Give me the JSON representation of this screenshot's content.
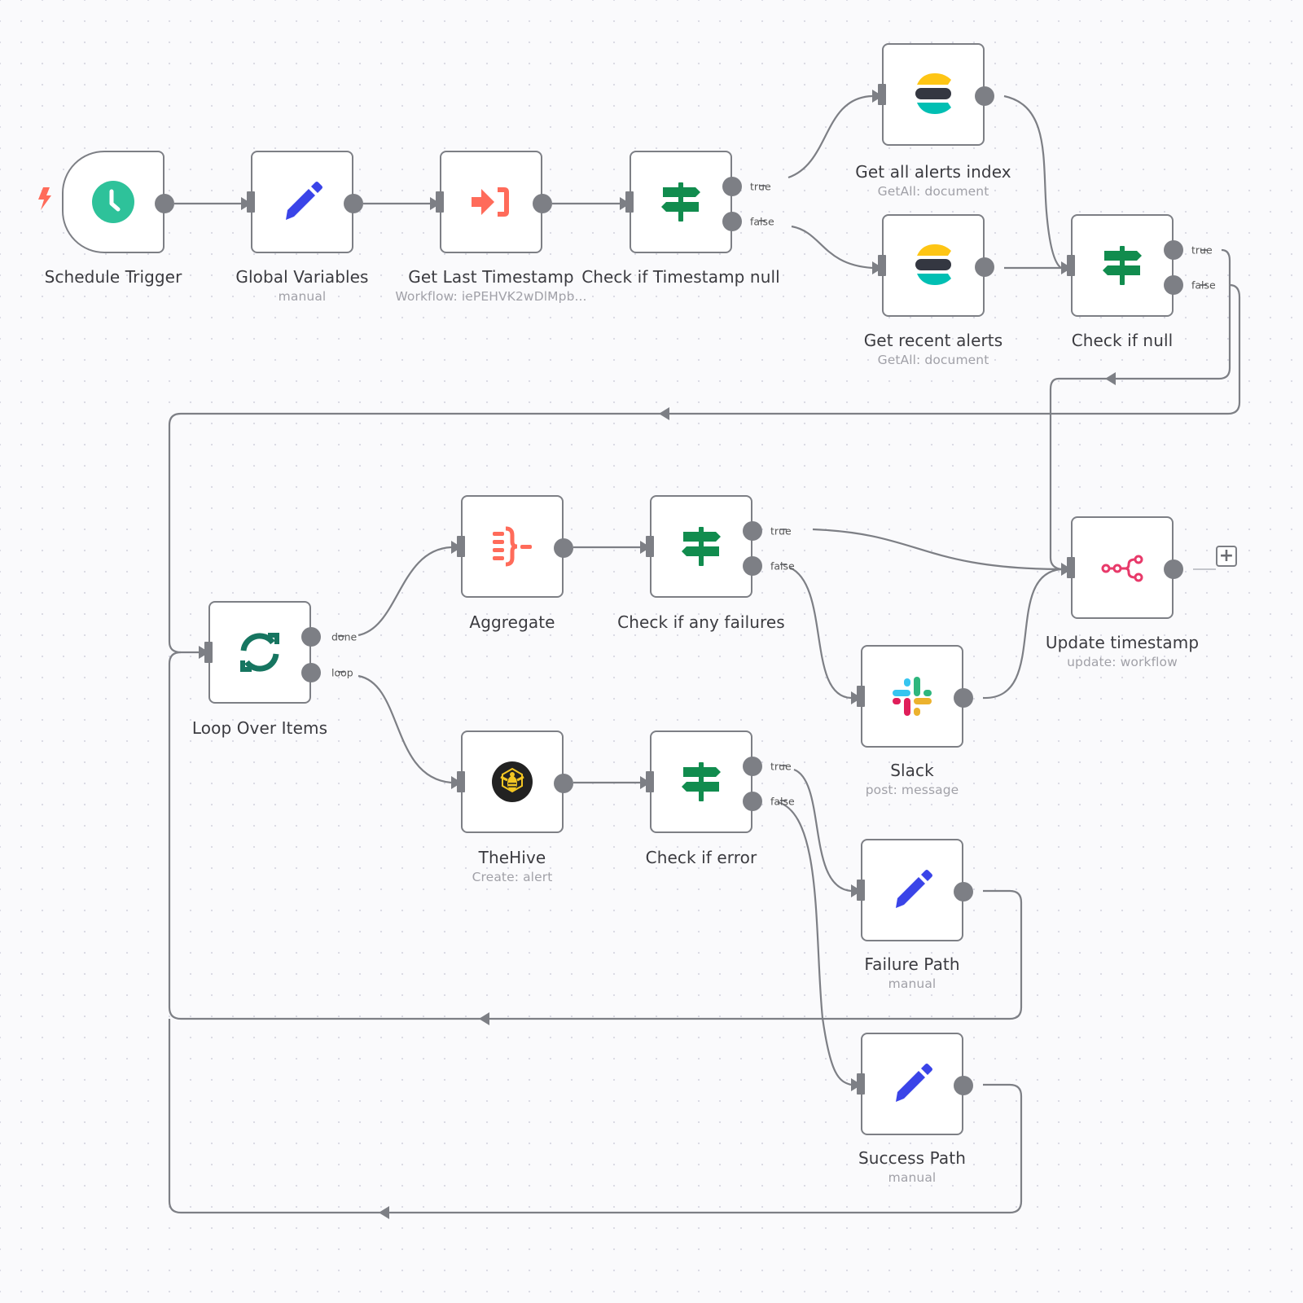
{
  "canvas": {
    "accent_colors": {
      "edge": "#7d7f85",
      "schedule_green": "#2ec29a",
      "set_blue": "#3a44e8",
      "exec_orange": "#ff6b5a",
      "if_green": "#118c4e",
      "loop_teal": "#167560",
      "n8n_pink": "#e83a6a"
    }
  },
  "nodes": {
    "schedule_trigger": {
      "title": "Schedule Trigger",
      "subtitle": "",
      "icon": "clock-icon"
    },
    "global_variables": {
      "title": "Global Variables",
      "subtitle": "manual",
      "icon": "pencil-icon"
    },
    "get_last_timestamp": {
      "title": "Get Last Timestamp",
      "subtitle": "Workflow: iePEHVK2wDlMpb...",
      "icon": "execute-workflow-icon"
    },
    "check_timestamp_null": {
      "title": "Check if Timestamp null",
      "subtitle": "",
      "icon": "signpost-icon",
      "outputs": [
        "true",
        "false"
      ]
    },
    "get_all_alerts_index": {
      "title": "Get all alerts index",
      "subtitle": "GetAll: document",
      "icon": "elasticsearch-icon"
    },
    "get_recent_alerts": {
      "title": "Get recent alerts",
      "subtitle": "GetAll: document",
      "icon": "elasticsearch-icon"
    },
    "check_if_null": {
      "title": "Check if null",
      "subtitle": "",
      "icon": "signpost-icon",
      "outputs": [
        "true",
        "false"
      ]
    },
    "loop_over_items": {
      "title": "Loop Over Items",
      "subtitle": "",
      "icon": "loop-icon",
      "outputs": [
        "done",
        "loop"
      ]
    },
    "aggregate": {
      "title": "Aggregate",
      "subtitle": "",
      "icon": "aggregate-icon"
    },
    "check_any_failures": {
      "title": "Check if any failures",
      "subtitle": "",
      "icon": "signpost-icon",
      "outputs": [
        "true",
        "false"
      ]
    },
    "update_timestamp": {
      "title": "Update timestamp",
      "subtitle": "update: workflow",
      "icon": "n8n-icon"
    },
    "slack": {
      "title": "Slack",
      "subtitle": "post: message",
      "icon": "slack-icon"
    },
    "thehive": {
      "title": "TheHive",
      "subtitle": "Create: alert",
      "icon": "thehive-icon"
    },
    "check_if_error": {
      "title": "Check if error",
      "subtitle": "",
      "icon": "signpost-icon",
      "outputs": [
        "true",
        "false"
      ]
    },
    "failure_path": {
      "title": "Failure Path",
      "subtitle": "manual",
      "icon": "pencil-icon"
    },
    "success_path": {
      "title": "Success Path",
      "subtitle": "manual",
      "icon": "pencil-icon"
    }
  },
  "add_node_button": {
    "label": "+"
  }
}
